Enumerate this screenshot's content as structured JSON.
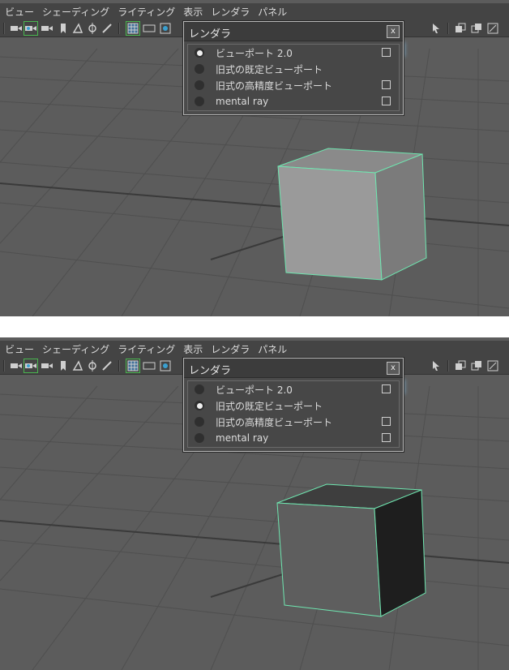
{
  "menubar": {
    "items": [
      "ビュー",
      "シェーディング",
      "ライティング",
      "表示",
      "レンダラ",
      "パネル"
    ]
  },
  "panels": [
    {
      "id": "top",
      "popup": {
        "title": "レンダラ",
        "close_label": "x",
        "options": [
          {
            "label": "ビューポート 2.0",
            "selected": true,
            "has_option_box": true
          },
          {
            "label": "旧式の既定ビューポート",
            "selected": false,
            "has_option_box": false
          },
          {
            "label": "旧式の高精度ビューポート",
            "selected": false,
            "has_option_box": true
          },
          {
            "label": "mental ray",
            "selected": false,
            "has_option_box": true
          }
        ]
      }
    },
    {
      "id": "bottom",
      "popup": {
        "title": "レンダラ",
        "close_label": "x",
        "options": [
          {
            "label": "ビューポート 2.0",
            "selected": false,
            "has_option_box": true
          },
          {
            "label": "旧式の既定ビューポート",
            "selected": true,
            "has_option_box": false
          },
          {
            "label": "旧式の高精度ビューポート",
            "selected": false,
            "has_option_box": true
          },
          {
            "label": "mental ray",
            "selected": false,
            "has_option_box": true
          }
        ]
      }
    }
  ],
  "colors": {
    "viewport": "#5a5a5a",
    "ui_bar": "#444444",
    "wire_highlight": "#6fe6b0"
  },
  "icons": [
    "camera-icon",
    "camera-select-icon",
    "camera-attr-icon",
    "bookmark-icon",
    "image-plane-icon",
    "2d-pan-icon",
    "grease-pencil-icon",
    "grid-icon",
    "film-gate-icon",
    "resolution-gate-icon",
    "select-tool-icon",
    "isolate-icon",
    "xray-icon",
    "maximize-icon"
  ]
}
